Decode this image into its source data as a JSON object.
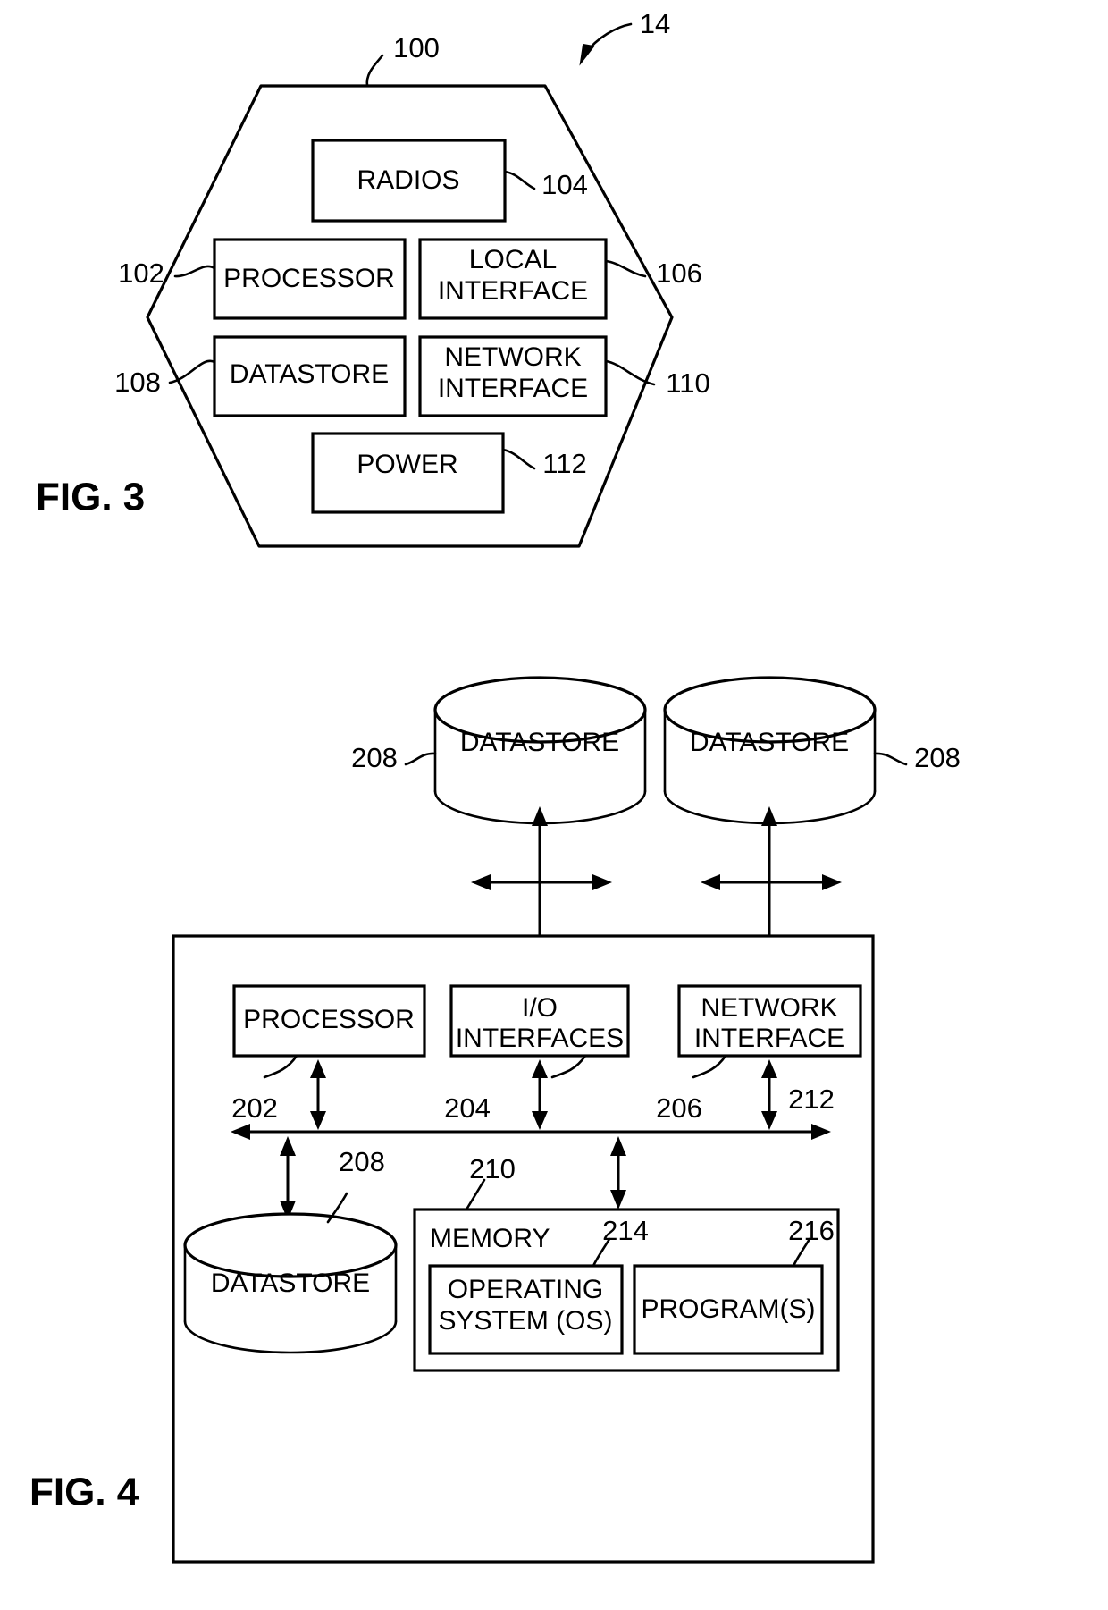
{
  "figures": [
    {
      "id": "fig3",
      "caption": "FIG. 3",
      "top_ref": "14",
      "outline_ref": "100",
      "blocks": [
        {
          "label": "RADIOS",
          "ref": "104"
        },
        {
          "label": "PROCESSOR",
          "ref": "102"
        },
        {
          "label": "LOCAL",
          "label2": "INTERFACE",
          "ref": "106"
        },
        {
          "label": "DATASTORE",
          "ref": "108"
        },
        {
          "label": "NETWORK",
          "label2": "INTERFACE",
          "ref": "110"
        },
        {
          "label": "POWER",
          "ref": "112"
        }
      ]
    },
    {
      "id": "fig4",
      "caption": "FIG. 4",
      "datastore_top_left": {
        "label": "DATASTORE",
        "ref": "208"
      },
      "datastore_top_right": {
        "label": "DATASTORE",
        "ref": "208"
      },
      "datastore_bottom": {
        "label": "DATASTORE",
        "ref": "208"
      },
      "blocks": [
        {
          "label": "PROCESSOR",
          "ref": "202"
        },
        {
          "label": "I/O",
          "label2": "INTERFACES",
          "ref": "204"
        },
        {
          "label": "NETWORK",
          "label2": "INTERFACE",
          "ref": "206"
        }
      ],
      "bus_ref": "212",
      "memory": {
        "label": "MEMORY",
        "ref": "210",
        "items": [
          {
            "label": "OPERATING",
            "label2": "SYSTEM (OS)",
            "ref": "214"
          },
          {
            "label": "PROGRAM(S)",
            "label2": "",
            "ref": "216"
          }
        ]
      }
    }
  ],
  "colors": {
    "ink": "#000000",
    "paper": "#ffffff"
  }
}
